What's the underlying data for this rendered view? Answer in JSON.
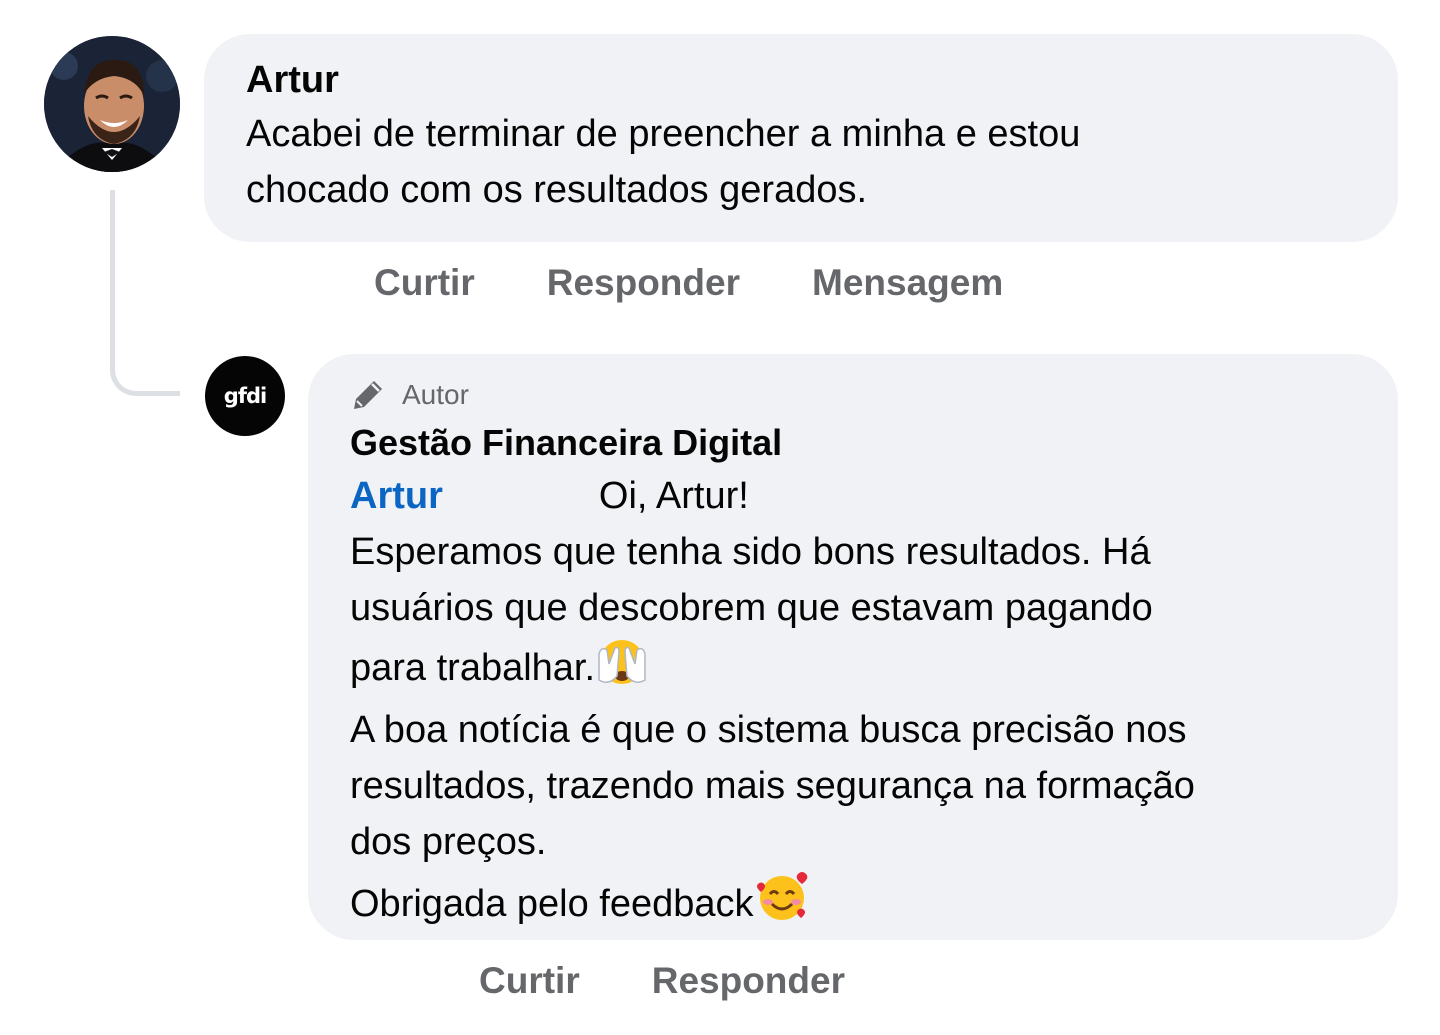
{
  "comment": {
    "author": "Artur",
    "text_line1": "Acabei de terminar de preencher a minha e estou",
    "text_line2": "chocado com os resultados gerados.",
    "actions": {
      "like": "Curtir",
      "reply": "Responder",
      "message": "Mensagem"
    }
  },
  "reply": {
    "avatar_text": "gfdi",
    "badge": "Autor",
    "page_name": "Gestão Financeira Digital",
    "mention": "Artur",
    "greeting": "Oi, Artur!",
    "lines": [
      "Esperamos que tenha sido bons resultados. Há",
      "usuários que descobrem que estavam pagando",
      "para trabalhar.",
      "A boa notícia é que o sistema busca precisão nos",
      "resultados, trazendo mais segurança na formação",
      "dos preços.",
      "Obrigada pelo feedback"
    ],
    "actions": {
      "like": "Curtir",
      "reply": "Responder"
    }
  },
  "icons": {
    "badge_icon": "pencil-icon",
    "emoji_1": "face-with-hands-over-eyes-emoji",
    "emoji_2": "smiling-face-with-hearts-emoji"
  }
}
